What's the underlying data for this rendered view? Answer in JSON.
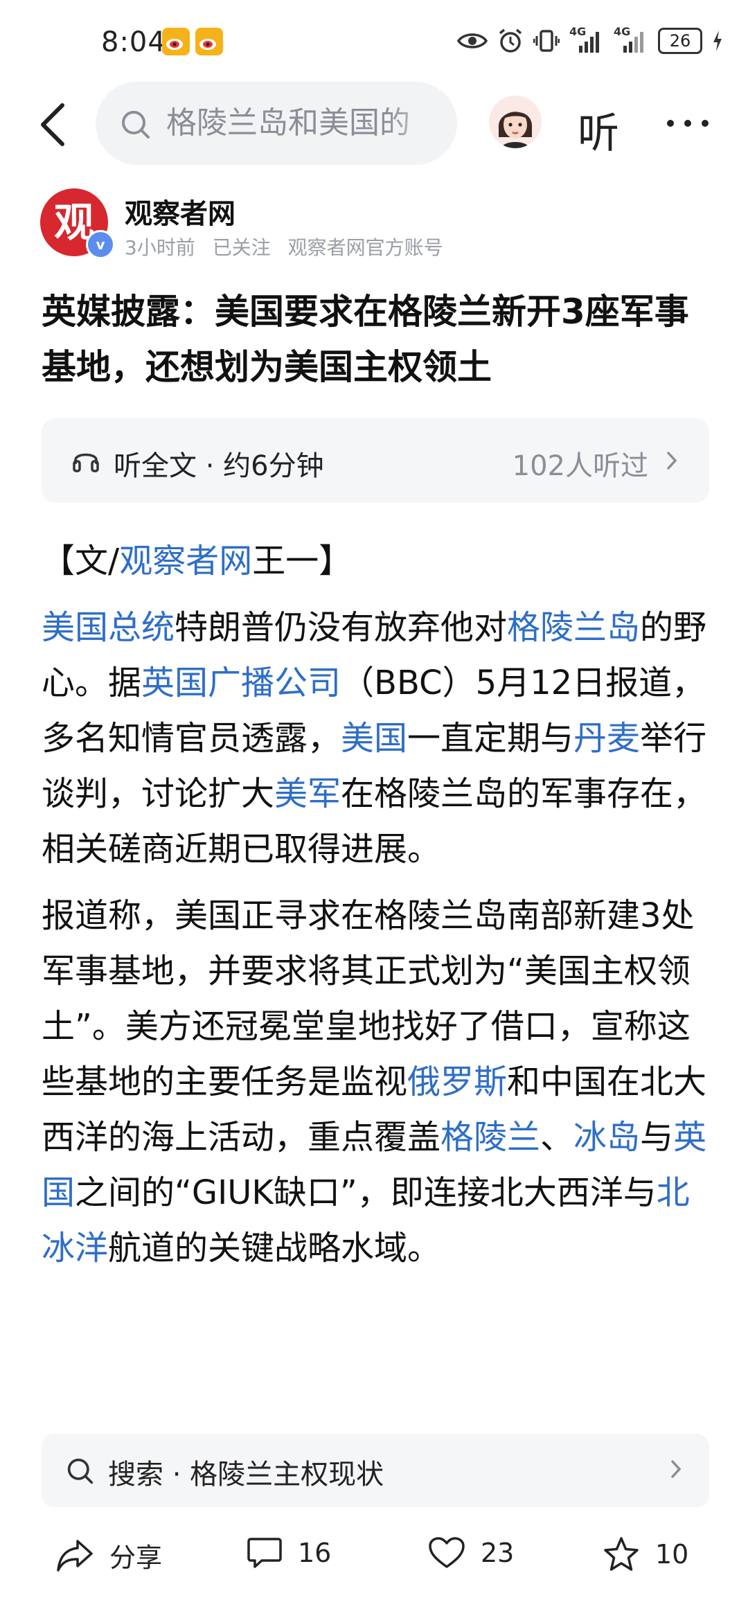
{
  "status_bar": {
    "time": "8:04",
    "network_labels": [
      "4G",
      "4G"
    ],
    "battery": "26",
    "icons": [
      "weibo-notification-icon",
      "weibo-notification-icon",
      "eye-icon",
      "alarm-icon",
      "vibrate-icon",
      "signal-icon",
      "signal-icon",
      "battery-icon",
      "charging-icon"
    ]
  },
  "nav": {
    "search_query": "格陵兰岛和美国的",
    "listen_label": "听"
  },
  "author": {
    "logo_char": "观",
    "name": "观察者网",
    "time_ago": "3小时前",
    "follow_status": "已关注",
    "account_desc": "观察者网官方账号"
  },
  "article": {
    "title": "英媒披露：美国要求在格陵兰新开3座军事基地，还想划为美国主权领土",
    "listen_bar": {
      "label": "听全文 · 约6分钟",
      "listeners": "102人听过"
    },
    "byline": {
      "open": "【文/",
      "source": "观察者网",
      "close": "王一】"
    },
    "p1": {
      "s1": "美国总统",
      "s2": "特朗普仍没有放弃他对",
      "s3": "格陵兰岛",
      "s4": "的野心。据",
      "s5": "英国广播公司",
      "s6": "（BBC）5月12日报道，多名知情官员透露，",
      "s7": "美国",
      "s8": "一直定期与",
      "s9": "丹麦",
      "s10": "举行谈判，讨论扩大",
      "s11": "美军",
      "s12": "在格陵兰岛的军事存在，相关磋商近期已取得进展。"
    },
    "p2": {
      "s1": "报道称，美国正寻求在格陵兰岛南部新建3处军事基地，并要求将其正式划为“美国主权领土”。美方还冠冕堂皇地找好了借口，宣称这些基地的主要任务是监视",
      "s2": "俄罗斯",
      "s3": "和中国在北大西洋的海上活动，重点覆盖",
      "s4": "格陵兰",
      "s5": "、",
      "s6": "冰岛",
      "s7": "与",
      "s8": "英国",
      "s9": "之间的“GIUK缺口”，即连接北大西洋与",
      "s10": "北冰洋",
      "s11": "航道的关键战略水域。"
    }
  },
  "related_search": {
    "label": "搜索 · 格陵兰主权现状"
  },
  "toolbar": {
    "share_label": "分享",
    "comment_count": "16",
    "like_count": "23",
    "favorite_count": "10"
  },
  "colors": {
    "link": "#2e6ec7",
    "logo_red": "#d7272f",
    "verify_blue": "#5b8def",
    "chip_bg": "#f5f6f8"
  }
}
